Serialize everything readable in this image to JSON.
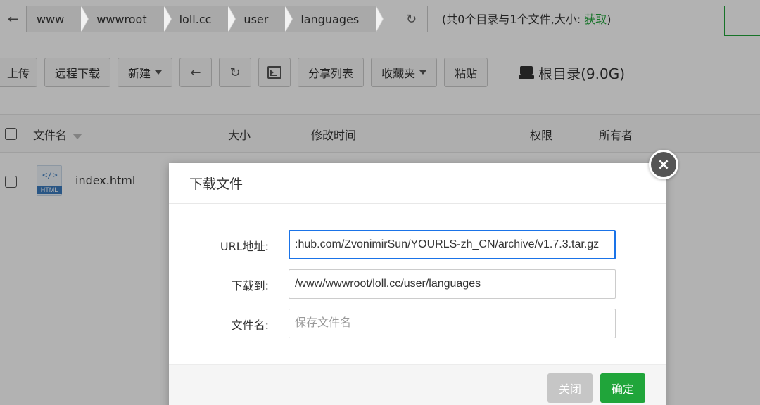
{
  "pathbar": {
    "back_icon": "arrow-left-icon",
    "crumbs": [
      "www",
      "wwwroot",
      "loll.cc",
      "user",
      "languages"
    ],
    "refresh_icon": "refresh-icon"
  },
  "summary": {
    "text": "(共0个目录与1个文件,大小: ",
    "link": "获取",
    "close_paren": ")"
  },
  "toolbar": {
    "upload": "上传",
    "remote_download": "远程下载",
    "new": "新建",
    "share_list": "分享列表",
    "favorites": "收藏夹",
    "paste": "粘贴",
    "disk_label": "根目录(9.0G)"
  },
  "table": {
    "headers": {
      "filename": "文件名",
      "size": "大小",
      "modified": "修改时间",
      "permissions": "权限",
      "owner": "所有者"
    },
    "rows": [
      {
        "name": "index.html",
        "icon_code": "</>",
        "icon_tag": "HTML"
      }
    ]
  },
  "modal": {
    "title": "下载文件",
    "fields": {
      "url_label": "URL地址:",
      "url_value": ":hub.com/ZvonimirSun/YOURLS-zh_CN/archive/v1.7.3.tar.gz",
      "dest_label": "下载到:",
      "dest_value": "/www/wwwroot/loll.cc/user/languages",
      "filename_label": "文件名:",
      "filename_placeholder": "保存文件名"
    },
    "close_btn": "关闭",
    "ok_btn": "确定",
    "close_icon": "×"
  },
  "colors": {
    "accent": "#20a53a",
    "focus": "#1a73e8"
  }
}
